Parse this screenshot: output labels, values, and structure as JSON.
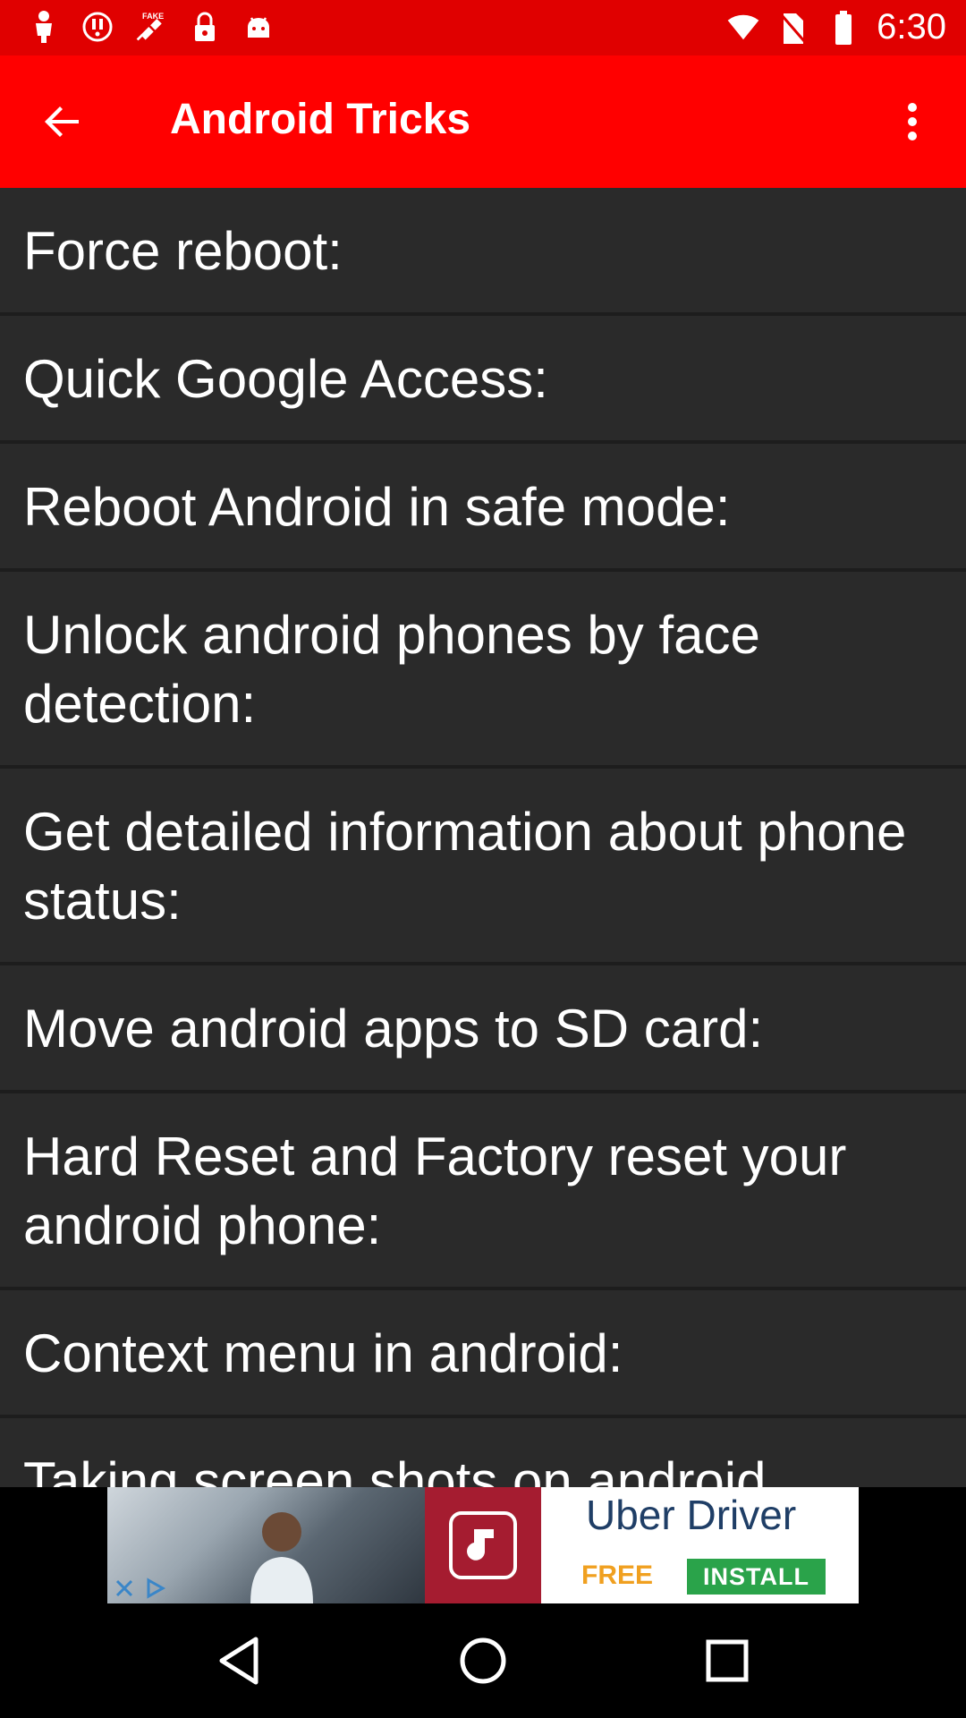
{
  "status_bar": {
    "time": "6:30",
    "left_icons": [
      "notification-icon",
      "alert-icon",
      "fake-gps-icon",
      "lock-icon",
      "android-icon"
    ],
    "right_icons": [
      "wifi-icon",
      "no-sim-icon",
      "battery-icon"
    ]
  },
  "app_bar": {
    "title": "Android Tricks",
    "back_icon": "arrow-back-icon",
    "menu_icon": "more-vert-icon"
  },
  "list": {
    "items": [
      {
        "label": "Force reboot:"
      },
      {
        "label": "Quick Google Access:"
      },
      {
        "label": "Reboot Android in safe mode:"
      },
      {
        "label": "Unlock android phones by face detection:"
      },
      {
        "label": "Get detailed information about phone status:"
      },
      {
        "label": "Move android apps to SD card:"
      },
      {
        "label": "Hard Reset and Factory reset your android phone:"
      },
      {
        "label": "Context menu in android:"
      },
      {
        "label": "Taking screen shots on android"
      }
    ]
  },
  "ad": {
    "headline": "Uber Driver",
    "free_label": "FREE",
    "install_label": "INSTALL"
  },
  "nav_bar": {
    "buttons": [
      "back-triangle-icon",
      "home-circle-icon",
      "recents-square-icon"
    ]
  },
  "colors": {
    "status_bar": "#e00000",
    "app_bar": "#ff0000",
    "list_bg": "#2a2a2a",
    "divider": "#1d1d1d",
    "text": "#ffffff"
  }
}
